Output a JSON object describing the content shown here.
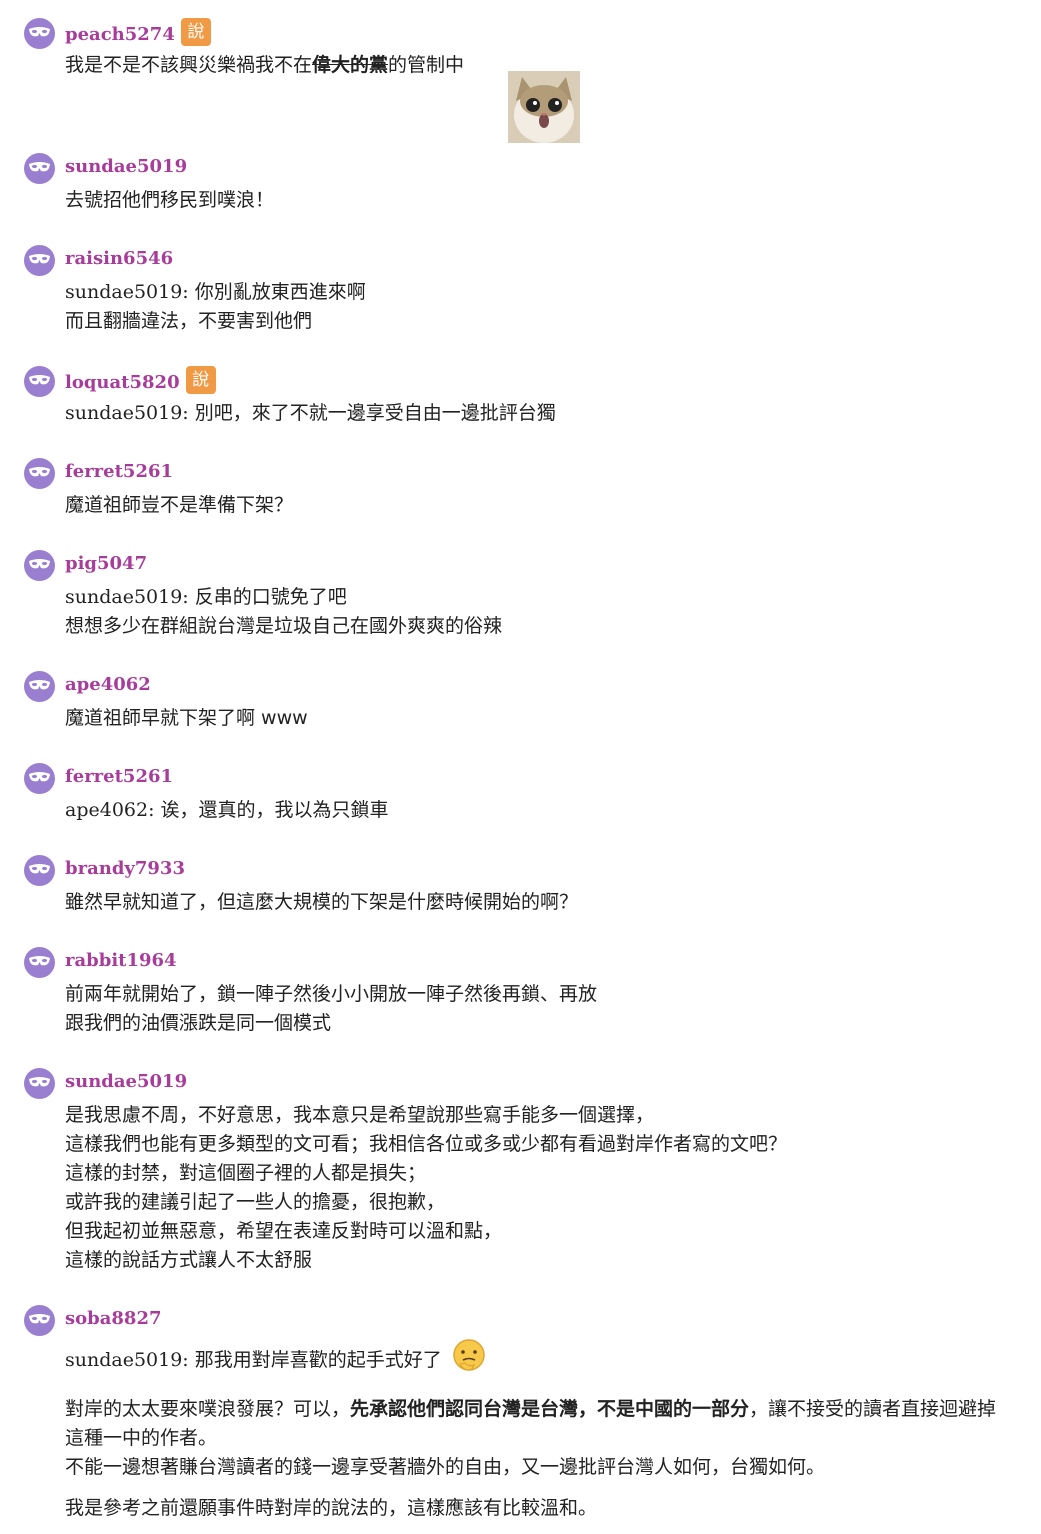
{
  "comments": [
    {
      "user": "peach5274",
      "badge": "說",
      "lines": [
        "我是不是不該興災樂禍我不在"
      ],
      "strike": "偉大的黨",
      "after": "的管制中"
    },
    {
      "user": "sundae5019",
      "lines": [
        "去號招他們移民到噗浪！"
      ]
    },
    {
      "user": "raisin6546",
      "reply_to": "sundae5019:",
      "lines": [
        "你別亂放東西進來啊",
        "而且翻牆違法，不要害到他們"
      ]
    },
    {
      "user": "loquat5820",
      "badge": "說",
      "reply_to": "sundae5019:",
      "lines": [
        "別吧，來了不就一邊享受自由一邊批評台獨"
      ]
    },
    {
      "user": "ferret5261",
      "lines": [
        "魔道祖師豈不是準備下架？"
      ]
    },
    {
      "user": "pig5047",
      "reply_to": "sundae5019:",
      "lines": [
        "反串的口號免了吧",
        "想想多少在群組說台灣是垃圾自己在國外爽爽的俗辣"
      ]
    },
    {
      "user": "ape4062",
      "lines": [
        "魔道祖師早就下架了啊 www"
      ]
    },
    {
      "user": "ferret5261",
      "reply_to": "ape4062:",
      "lines": [
        "诶，還真的，我以為只鎖車"
      ]
    },
    {
      "user": "brandy7933",
      "lines": [
        "雖然早就知道了，但這麼大規模的下架是什麼時候開始的啊？"
      ]
    },
    {
      "user": "rabbit1964",
      "lines": [
        "前兩年就開始了，鎖一陣子然後小小開放一陣子然後再鎖、再放",
        "跟我們的油價漲跌是同一個模式"
      ]
    },
    {
      "user": "sundae5019",
      "lines": [
        "是我思慮不周，不好意思，我本意只是希望說那些寫手能多一個選擇，",
        "這樣我們也能有更多類型的文可看；我相信各位或多或少都有看過對岸作者寫的文吧？",
        "這樣的封禁，對這個圈子裡的人都是損失；",
        "或許我的建議引起了一些人的擔憂，很抱歉，",
        "但我起初並無惡意，希望在表達反對時可以溫和點，",
        "這樣的說話方式讓人不太舒服"
      ]
    },
    {
      "user": "soba8827",
      "reply_to": "sundae5019:",
      "first": "那我用對岸喜歡的起手式好了",
      "p1_a": "對岸的太太要來噗浪發展？可以，",
      "p1_bold": "先承認他們認同台灣是台灣，不是中國的一部分",
      "p1_b": "，讓不接受的讀者直接迴避掉這種一中的作者。",
      "p2": "不能一邊想著賺台灣讀者的錢一邊享受著牆外的自由，又一邊批評台灣人如何，台獨如何。",
      "p3": "我是參考之前還願事件時對岸的說法的，這樣應該有比較溫和。"
    }
  ]
}
